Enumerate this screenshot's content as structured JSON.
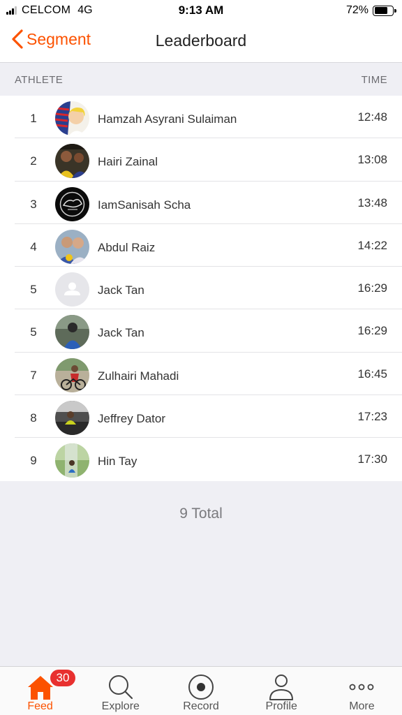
{
  "status_bar": {
    "carrier": "CELCOM",
    "network": "4G",
    "time": "9:13 AM",
    "battery_percent": "72%",
    "battery_level": 0.72
  },
  "nav": {
    "back_label": "Segment",
    "title": "Leaderboard"
  },
  "columns": {
    "athlete": "ATHLETE",
    "time": "TIME"
  },
  "leaderboard": [
    {
      "rank": "1",
      "name": "Hamzah Asyrani Sulaiman",
      "time": "12:48"
    },
    {
      "rank": "2",
      "name": "Hairi Zainal",
      "time": "13:08"
    },
    {
      "rank": "3",
      "name": "IamSanisah Scha",
      "time": "13:48"
    },
    {
      "rank": "4",
      "name": "Abdul Raiz",
      "time": "14:22"
    },
    {
      "rank": "5",
      "name": "Jack Tan",
      "time": "16:29"
    },
    {
      "rank": "5",
      "name": "Jack Tan",
      "time": "16:29"
    },
    {
      "rank": "7",
      "name": "Zulhairi Mahadi",
      "time": "16:45"
    },
    {
      "rank": "8",
      "name": "Jeffrey Dator",
      "time": "17:23"
    },
    {
      "rank": "9",
      "name": "Hin Tay",
      "time": "17:30"
    }
  ],
  "total_label": "9 Total",
  "tab_bar": {
    "tabs": [
      {
        "label": "Feed",
        "icon": "home-icon",
        "active": true,
        "badge": "30"
      },
      {
        "label": "Explore",
        "icon": "search-icon"
      },
      {
        "label": "Record",
        "icon": "record-icon"
      },
      {
        "label": "Profile",
        "icon": "profile-icon"
      },
      {
        "label": "More",
        "icon": "more-icon"
      }
    ]
  },
  "colors": {
    "accent": "#fc5200",
    "badge": "#e8302f"
  }
}
